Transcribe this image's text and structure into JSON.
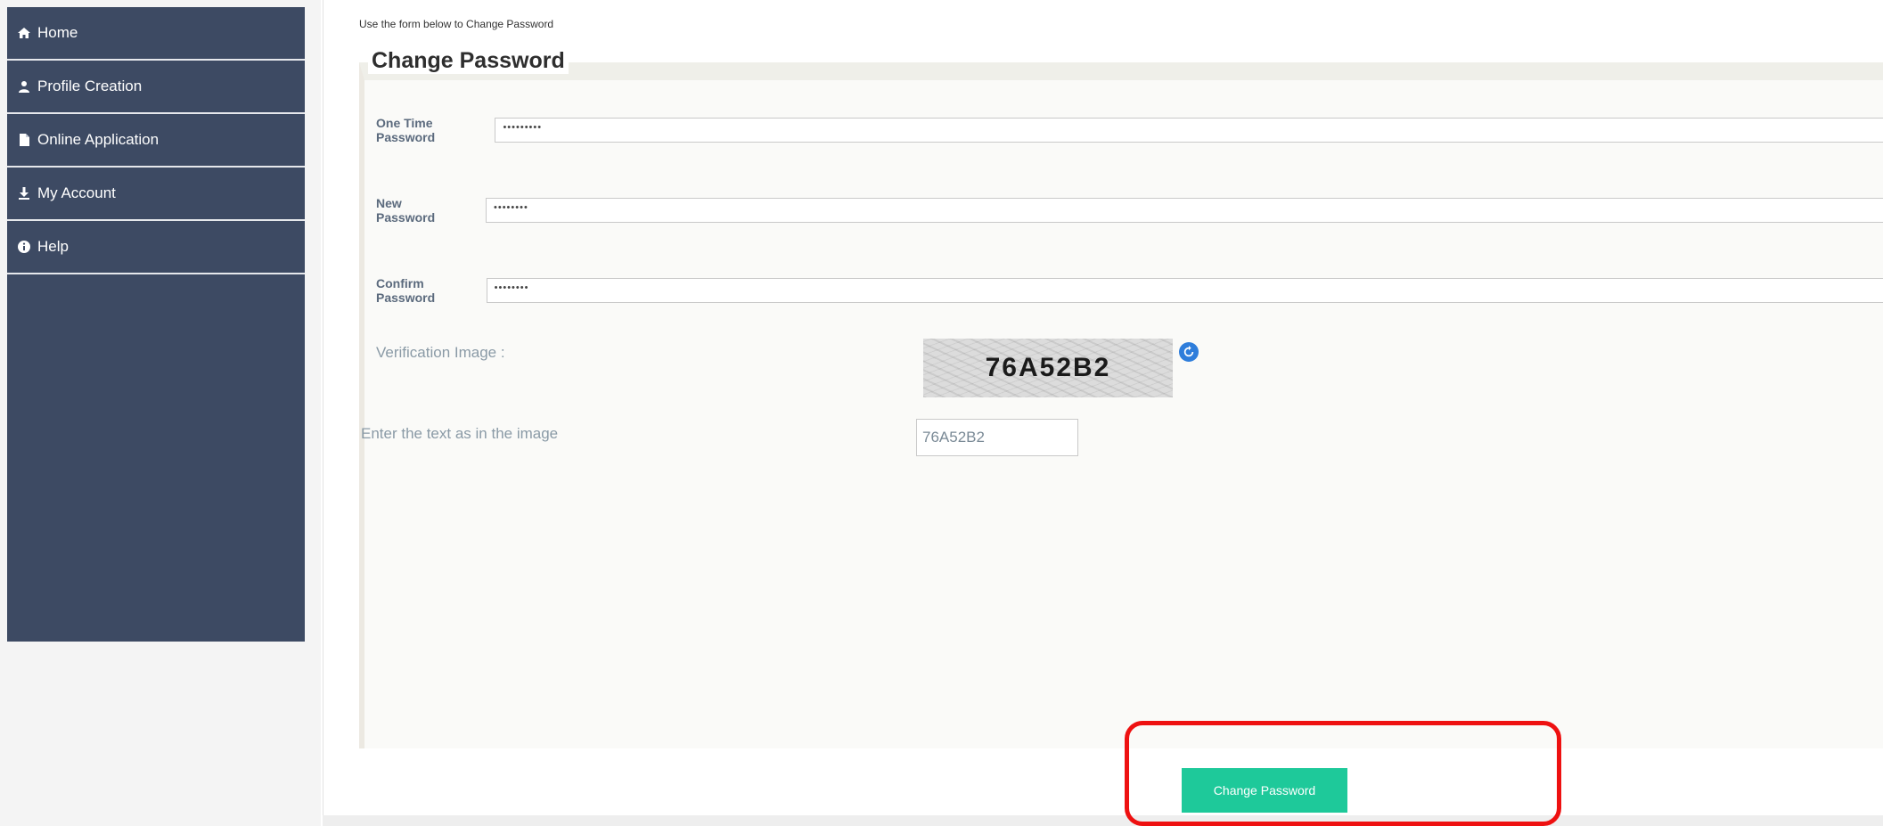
{
  "sidebar": {
    "items": [
      {
        "label": "Home",
        "icon": "home-icon"
      },
      {
        "label": "Profile Creation",
        "icon": "user-icon"
      },
      {
        "label": "Online Application",
        "icon": "document-icon"
      },
      {
        "label": "My Account",
        "icon": "account-icon"
      },
      {
        "label": "Help",
        "icon": "info-icon"
      }
    ]
  },
  "main": {
    "intro": "Use the form below to Change Password",
    "legend": "Change Password",
    "fields": {
      "otp": {
        "label": "One Time Password",
        "value": "•••••••••"
      },
      "new_password": {
        "label": "New Password",
        "value": "••••••••"
      },
      "confirm_password": {
        "label": "Confirm Password",
        "value": "••••••••"
      }
    },
    "captcha": {
      "label": "Verification Image :",
      "image_text": "76A52B2",
      "prompt": "Enter the text as in the image",
      "input_value": "76A52B2"
    },
    "submit_label": "Change Password"
  },
  "colors": {
    "sidebar_bg": "#3d4a63",
    "button_bg": "#1ec99a",
    "highlight": "#ee1111",
    "refresh_icon": "#2e7ddb"
  }
}
